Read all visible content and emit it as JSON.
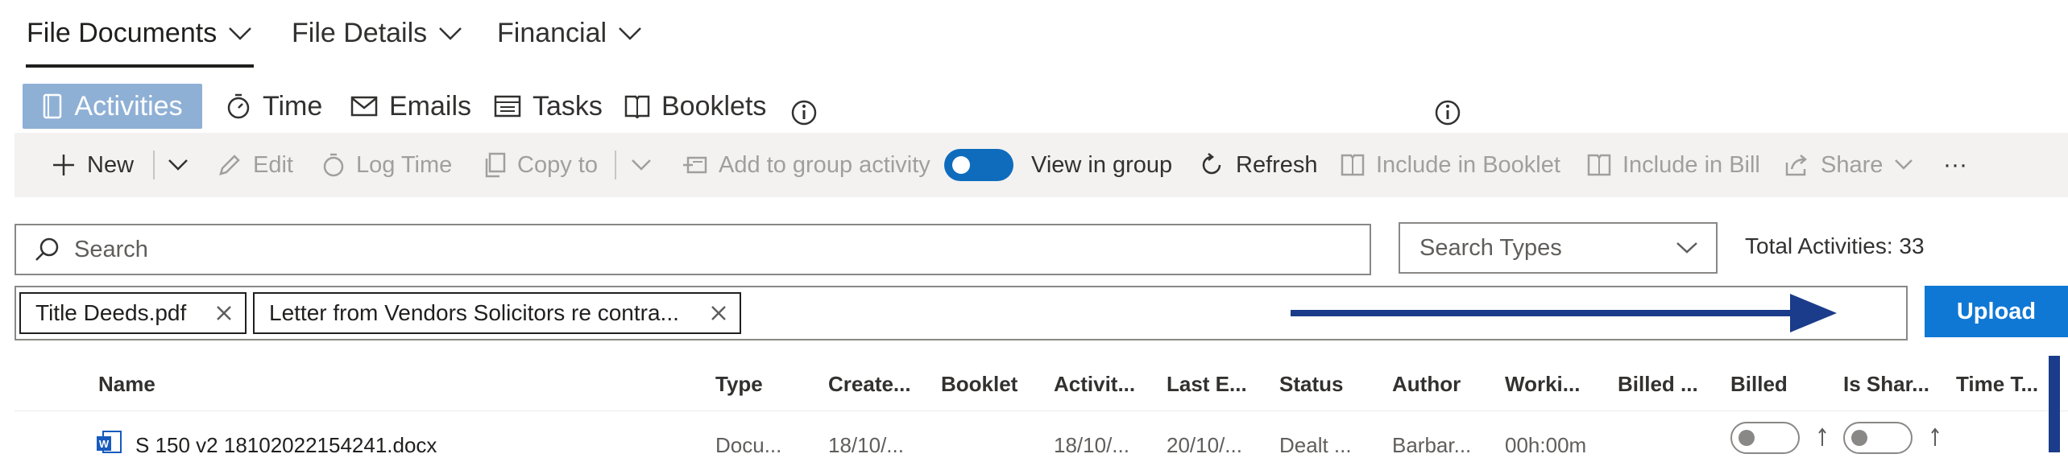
{
  "top_nav": {
    "items": [
      {
        "label": "File Documents",
        "icon": "chevron-down-icon"
      },
      {
        "label": "File Details",
        "icon": "chevron-down-icon"
      },
      {
        "label": "Financial",
        "icon": "chevron-down-icon"
      }
    ]
  },
  "sub_tabs": {
    "items": [
      {
        "label": "Activities",
        "icon": "book-icon"
      },
      {
        "label": "Time",
        "icon": "stopwatch-icon"
      },
      {
        "label": "Emails",
        "icon": "mail-icon"
      },
      {
        "label": "Tasks",
        "icon": "task-list-icon"
      },
      {
        "label": "Booklets",
        "icon": "booklet-icon"
      }
    ],
    "info_icon": "info-icon"
  },
  "toolbar": {
    "new": "New",
    "edit": "Edit",
    "log_time": "Log Time",
    "copy_to": "Copy to",
    "add_group": "Add to group activity",
    "view_in_group": "View in group",
    "refresh": "Refresh",
    "include_booklet": "Include in Booklet",
    "include_bill": "Include in Bill",
    "share": "Share",
    "more": "···",
    "view_in_group_on": true
  },
  "search": {
    "placeholder": "Search",
    "types_placeholder": "Search Types",
    "total_label": "Total Activities: 33"
  },
  "attachments": {
    "chips": [
      "Title Deeds.pdf",
      "Letter from Vendors Solicitors re contra..."
    ],
    "upload_label": "Upload"
  },
  "table": {
    "headers": [
      "Name",
      "Type",
      "Create...",
      "Booklet",
      "Activit...",
      "Last E...",
      "Status",
      "Author",
      "Worki...",
      "Billed ...",
      "Billed",
      "Is Shar...",
      "Time T..."
    ],
    "rows": [
      {
        "name": "S 150 v2 18102022154241.docx",
        "type": "Docu...",
        "created": "18/10/...",
        "booklet": "",
        "activity": "18/10/...",
        "last_edited": "20/10/...",
        "status": "Dealt ...",
        "author": "Barbar...",
        "working": "00h:00m"
      }
    ]
  },
  "colors": {
    "accent": "#0f78d4",
    "active_tab": "#8fb0d5",
    "arrow": "#1b3c8a"
  }
}
